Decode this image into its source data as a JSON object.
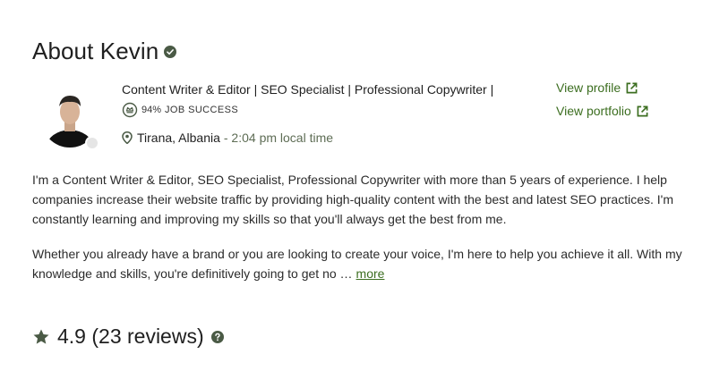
{
  "profile": {
    "title": "About Kevin",
    "headline": "Content Writer & Editor | SEO Specialist | Professional Copywriter |",
    "job_success_percent": "94%",
    "job_success_label": "JOB SUCCESS",
    "location": "Tirana, Albania",
    "local_time": "- 2:04 pm local time"
  },
  "links": {
    "view_profile": "View profile",
    "view_portfolio": "View portfolio"
  },
  "bio": {
    "paragraph1": "I'm a Content Writer & Editor, SEO Specialist, Professional Copywriter with more than 5 years of experience. I help companies increase their website traffic by providing high-quality content with the best and latest SEO practices. I'm constantly learning and improving my skills so that you'll always get the best from me.",
    "paragraph2": "Whether you already have a brand or you are looking to create your voice, I'm here to help you achieve it all. With my knowledge and skills, you're definitively going to get no …",
    "more_label": "more"
  },
  "rating": {
    "text": "4.9 (23 reviews)"
  },
  "icons": {
    "verified": "verified-badge-icon",
    "job_success": "job-success-badge-icon",
    "location": "location-pin-icon",
    "external": "external-link-icon",
    "star": "star-icon",
    "help": "help-icon"
  },
  "colors": {
    "accent": "#3c6e20",
    "icon_gray": "#4a5a45",
    "text": "#1f1f1f"
  }
}
